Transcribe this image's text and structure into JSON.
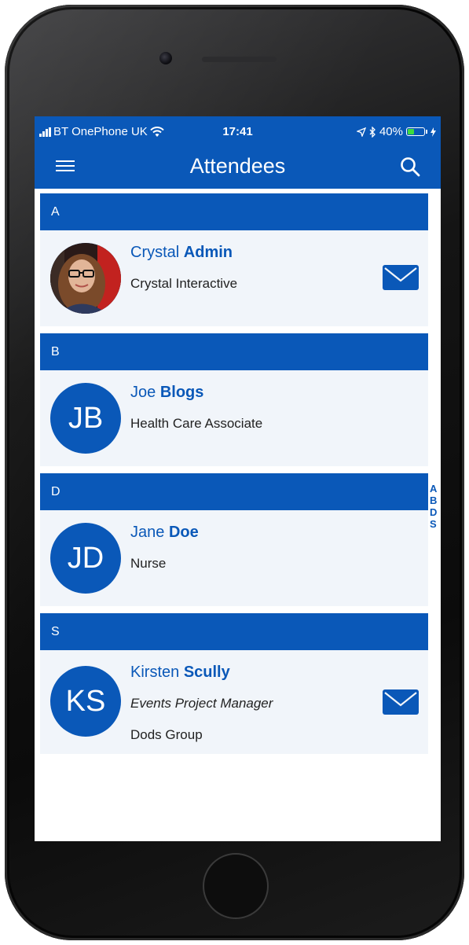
{
  "status": {
    "carrier": "BT OnePhone UK",
    "time": "17:41",
    "battery": "40%",
    "battery_level": 0.4
  },
  "nav": {
    "title": "Attendees",
    "menu_icon": "hamburger-menu-icon",
    "search_icon": "search-icon"
  },
  "colors": {
    "primary": "#0a58b8",
    "card_bg": "#f1f5fa"
  },
  "sections": [
    {
      "letter": "A",
      "first": "Crystal",
      "last": "Admin",
      "initials": "",
      "line1": "Crystal Interactive",
      "line2": "",
      "has_mail": true
    },
    {
      "letter": "B",
      "first": "Joe",
      "last": "Blogs",
      "initials": "JB",
      "line1": "Health Care Associate",
      "line2": "",
      "has_mail": false
    },
    {
      "letter": "D",
      "first": "Jane",
      "last": "Doe",
      "initials": "JD",
      "line1": "Nurse",
      "line2": "",
      "has_mail": false
    },
    {
      "letter": "S",
      "first": "Kirsten",
      "last": "Scully",
      "initials": "KS",
      "line1": "Events Project Manager",
      "line2": "Dods Group",
      "has_mail": true
    }
  ],
  "index": [
    "A",
    "B",
    "D",
    "S"
  ]
}
